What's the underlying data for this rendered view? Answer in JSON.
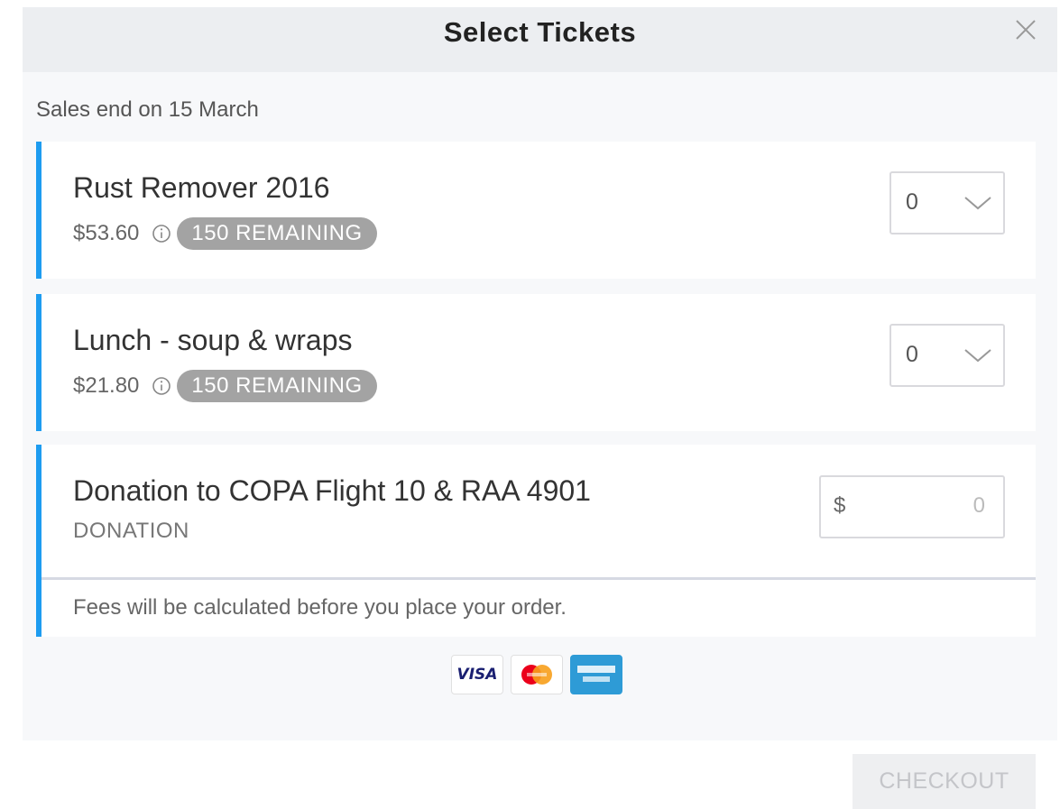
{
  "modal": {
    "title": "Select Tickets",
    "sales_end": "Sales end on 15 March"
  },
  "tickets": [
    {
      "name": "Rust Remover 2016",
      "price": "$53.60",
      "remaining": "150 REMAINING",
      "quantity": "0"
    },
    {
      "name": "Lunch - soup & wraps",
      "price": "$21.80",
      "remaining": "150 REMAINING",
      "quantity": "0"
    }
  ],
  "donation": {
    "name": "Donation to COPA Flight 10 & RAA 4901",
    "label": "DONATION",
    "currency": "$",
    "value": "0"
  },
  "fees_note": "Fees will be calculated before you place your order.",
  "payment_methods": [
    {
      "name": "visa",
      "label": "VISA"
    },
    {
      "name": "mastercard",
      "label": "MasterCard"
    },
    {
      "name": "american-express",
      "label": "AMERICAN EXPRESS"
    }
  ],
  "checkout": {
    "label": "CHECKOUT"
  },
  "colors": {
    "accent": "#1e9cf0",
    "badge": "#a3a3a3",
    "header_bg": "#eceef1",
    "modal_bg": "#f7f8fa"
  },
  "icons": [
    "close-icon",
    "info-icon",
    "chevron-down-icon"
  ]
}
